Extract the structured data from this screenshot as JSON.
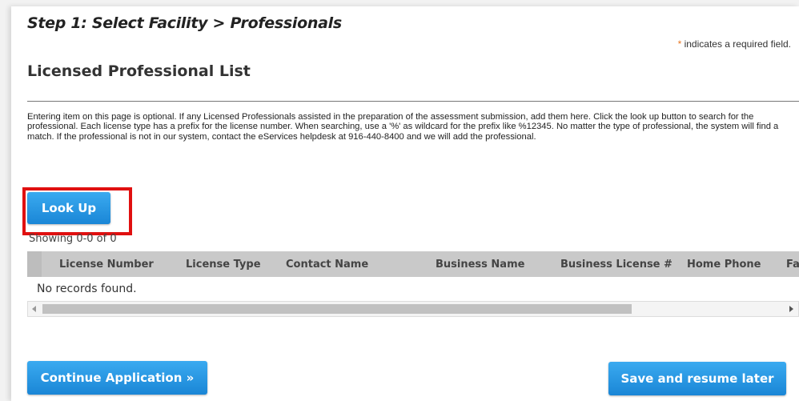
{
  "step_title": "Step 1: Select Facility > Professionals",
  "required_note": {
    "star": "*",
    "text": " indicates a required field."
  },
  "section_title": "Licensed Professional List",
  "instructions": "Entering item on this page is optional.  If any Licensed Professionals assisted in the preparation of the assessment submission, add them here. Click the look up button to search for the professional.  Each license type has a prefix for the license number.  When searching, use a '%' as wildcard for the prefix like %12345.  No matter the type of professional, the system will find a match.  If the professional is not in our system, contact the eServices helpdesk at 916-440-8400 and we will add the professional.",
  "lookup_button": "Look Up",
  "showing": "Showing 0-0 of 0",
  "grid": {
    "columns": [
      "License Number",
      "License Type",
      "Contact Name",
      "Business Name",
      "Business License #",
      "Home Phone",
      "Fa"
    ],
    "empty_message": "No records found."
  },
  "buttons": {
    "continue": "Continue Application »",
    "save": "Save and resume later"
  },
  "colors": {
    "button": "#1a86d6",
    "highlight": "#e01010",
    "required_star": "#e87722"
  }
}
